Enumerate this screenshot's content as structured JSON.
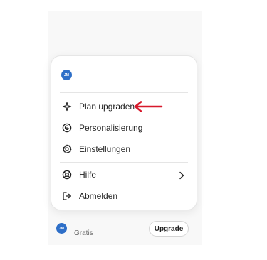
{
  "user": {
    "initials": "JM",
    "plan_label": "Gratis"
  },
  "menu": {
    "items": [
      {
        "label": "Plan upgraden",
        "icon": "sparkle-icon"
      },
      {
        "label": "Personalisierung",
        "icon": "personalize-icon"
      },
      {
        "label": "Einstellungen",
        "icon": "gear-icon"
      },
      {
        "label": "Hilfe",
        "icon": "lifebuoy-icon",
        "has_submenu": true
      },
      {
        "label": "Abmelden",
        "icon": "logout-icon"
      }
    ]
  },
  "footer": {
    "upgrade_label": "Upgrade"
  },
  "colors": {
    "accent": "#2e6fc8",
    "annotation_arrow": "#d7192b"
  }
}
